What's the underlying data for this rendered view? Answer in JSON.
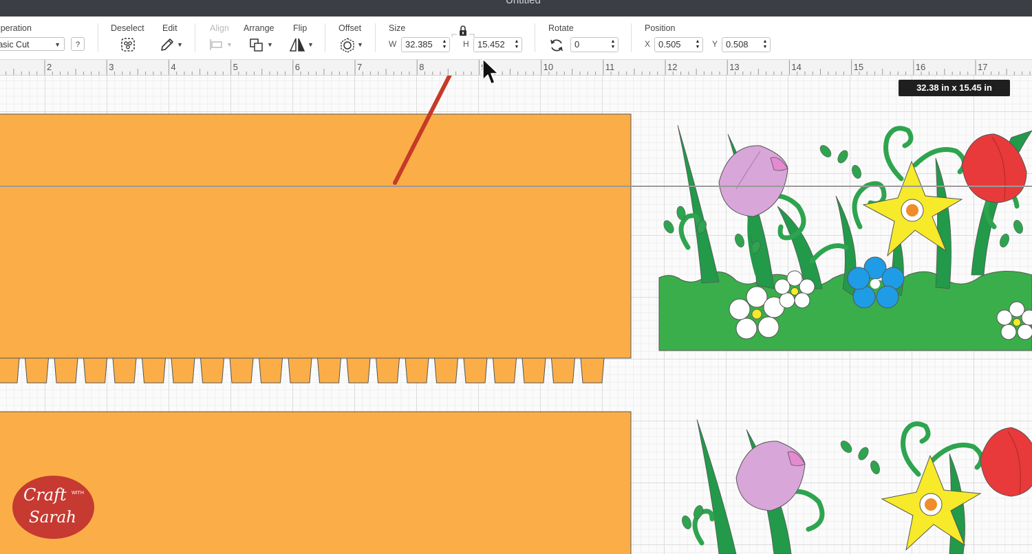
{
  "window": {
    "title": "Untitled"
  },
  "toolbar": {
    "operation": {
      "label": "Operation",
      "value": "Basic Cut",
      "help": "?"
    },
    "deselect": {
      "label": "Deselect"
    },
    "edit": {
      "label": "Edit"
    },
    "align": {
      "label": "Align"
    },
    "arrange": {
      "label": "Arrange"
    },
    "flip": {
      "label": "Flip"
    },
    "offset": {
      "label": "Offset"
    },
    "size": {
      "label": "Size",
      "w_label": "W",
      "w_value": "32.385",
      "h_label": "H",
      "h_value": "15.452"
    },
    "rotate": {
      "label": "Rotate",
      "value": "0"
    },
    "position": {
      "label": "Position",
      "x_label": "X",
      "x_value": "0.505",
      "y_label": "Y",
      "y_value": "0.508"
    }
  },
  "ruler": {
    "numbers": [
      "2",
      "3",
      "4",
      "5",
      "6",
      "7",
      "8",
      "9",
      "10",
      "11",
      "12",
      "13",
      "14",
      "15",
      "16",
      "17"
    ]
  },
  "tooltip": {
    "size_text": "32.38  in x 15.45  in"
  },
  "logo": {
    "line1": "Craft",
    "line2": "WITH",
    "line3": "Sarah"
  },
  "colors": {
    "orange": "#fbae47",
    "grass": "#3aae4a",
    "leaf": "#23994a",
    "tulip_pink": "#d8a6d8",
    "tulip_red": "#e83a3a",
    "daffodil": "#f6ea2a",
    "forget_me_not": "#1f9ce6",
    "arrow": "#c63a28"
  }
}
